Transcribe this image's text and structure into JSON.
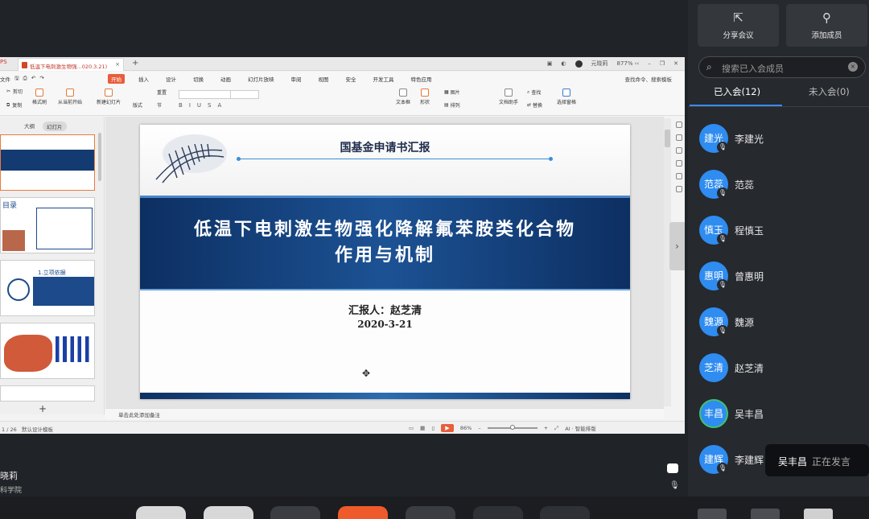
{
  "wps": {
    "logo": "PS",
    "tab_title": "低温下电刺激生物强...020.3.21)",
    "tab_close": "×",
    "new_tab": "+",
    "title_user": "元晓莉",
    "title_storage": "877% ‹‹",
    "menu_file": "文件",
    "menu_tabs": [
      "开始",
      "插入",
      "设计",
      "切换",
      "动画",
      "幻灯片放映",
      "审阅",
      "视图",
      "安全",
      "开发工具",
      "特色应用"
    ],
    "menu_search": "查找命令、搜索模板",
    "ribbon": {
      "cut": "剪切",
      "copy": "复制",
      "format_painter": "格式刷",
      "play_from_current": "从当前开始",
      "new_slide": "新建幻灯片",
      "layout": "版式",
      "section": "节",
      "reset": "重置",
      "textbox": "文本框",
      "shape": "形状",
      "picture": "图片",
      "arrange": "排列",
      "replace_label": "替换",
      "doc_assistant": "文档助手",
      "find": "查找",
      "replace": "替换",
      "select_pane": "选择窗格"
    },
    "thumb_tabs": {
      "outline": "大纲",
      "slides": "幻灯片"
    },
    "thumb_add": "+",
    "thumb2_title": "目录",
    "thumb3_title": "1.立项依据",
    "slide": {
      "header_title": "国基金申请书汇报",
      "title_line1": "低温下电刺激生物强化降解氟苯胺类化合物",
      "title_line2": "作用与机制",
      "reporter": "汇报人：赵芝清",
      "date": "2020-3-21"
    },
    "notes_placeholder": "单击此处添加备注",
    "status_left": "1 / 26",
    "status_template": "默认设计模板",
    "zoom": "86%",
    "ai_label": "AI · 智能排版"
  },
  "presenter": {
    "name": "晓莉",
    "org": "科学院"
  },
  "sidebar": {
    "share_label": "分享会议",
    "add_label": "添加成员",
    "search_placeholder": "搜索已入会成员",
    "tab_joined": "已入会(12)",
    "tab_not_joined": "未入会(0)",
    "members": [
      {
        "avatar": "建光",
        "name": "李建光"
      },
      {
        "avatar": "范蕊",
        "name": "范蕊"
      },
      {
        "avatar": "慎玉",
        "name": "程慎玉"
      },
      {
        "avatar": "惠明",
        "name": "曾惠明"
      },
      {
        "avatar": "魏源",
        "name": "魏源"
      },
      {
        "avatar": "芝清",
        "name": "赵芝清"
      },
      {
        "avatar": "丰昌",
        "name": "吴丰昌"
      },
      {
        "avatar": "建辉",
        "name": "李建辉"
      }
    ],
    "speaking_name": "吴丰昌",
    "speaking_status": "正在发言"
  },
  "colors": {
    "accent": "#2f8cf0",
    "speaking_ring": "#3fc46b",
    "wps_orange": "#e85d3a",
    "slide_band": "#1c5294"
  }
}
